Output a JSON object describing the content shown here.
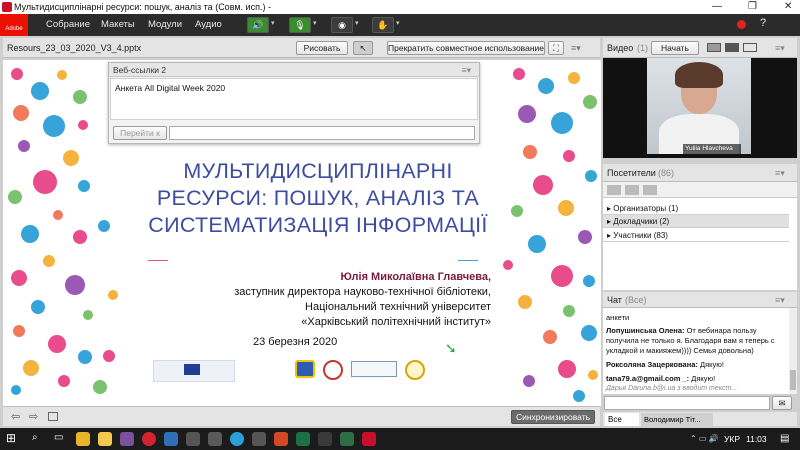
{
  "window": {
    "title": "Мультидисциплінарні ресурси: пошук, аналіз та (Совм. исп.) -"
  },
  "menubar": {
    "items": [
      "Собрание",
      "Макеты",
      "Модули",
      "Аудио"
    ],
    "adobe_label": "Adobe"
  },
  "share_pod": {
    "filename": "Resours_23_03_2020_V3_4.pptx",
    "draw_button": "Рисовать",
    "stop_sharing_button": "Прекратить совместное использование",
    "sync_button": "Синхронизировать"
  },
  "weblinks_pod": {
    "title": "Веб-ссылки 2",
    "link": "Анкета All Digital Week 2020",
    "go_button": "Перейти к",
    "url_value": ""
  },
  "slide": {
    "heading_lines": [
      "МУЛЬТИДИСЦИПЛІНАРНІ",
      "РЕСУРСИ: ПОШУК, АНАЛІЗ ТА",
      "СИСТЕМАТИЗАЦІЯ ІНФОРМАЦІЇ"
    ],
    "author_name": "Юлія Миколаївна Главчева,",
    "author_lines": [
      "заступник директора науково-технічної бібліотеки,",
      "Національний технічний університет",
      "«Харківський політехнічний інститут»"
    ],
    "date": "23 березня 2020"
  },
  "video_pod": {
    "title": "Видео",
    "badge": "(1)",
    "start_button": "Начать",
    "participant_name": "Yuliia Hlavcheva"
  },
  "attendees_pod": {
    "title": "Посетители",
    "count": "(86)",
    "groups": [
      {
        "label": "Организаторы",
        "count": "(1)"
      },
      {
        "label": "Докладчики",
        "count": "(2)"
      },
      {
        "label": "Участники",
        "count": "(83)"
      }
    ]
  },
  "chat_pod": {
    "title": "Чат",
    "scope": "(Все)",
    "messages": [
      {
        "author": "",
        "text": "анкети"
      },
      {
        "author": "Лопушинська Олена:",
        "text": "От вебинара пользу получила не только я. Благодаря вам я теперь с укладкой и макияжем)))) Семья довольна)"
      },
      {
        "author": "Роксоляна Зацеркована:",
        "text": "Дякую!"
      },
      {
        "author": "tana79.a@gmail.com _:",
        "text": "Дякую!"
      }
    ],
    "typing": "Дарья Daruna.b@i.ua з вводит текст...",
    "input_value": "",
    "tabs": [
      "Все",
      "Володимир Тіт..."
    ]
  },
  "taskbar": {
    "lang": "УКР",
    "time": "11:03"
  },
  "colors": {
    "heading": "#3d4ca0",
    "menubar": "#2b2b2b",
    "adobe_red": "#eb1000"
  }
}
